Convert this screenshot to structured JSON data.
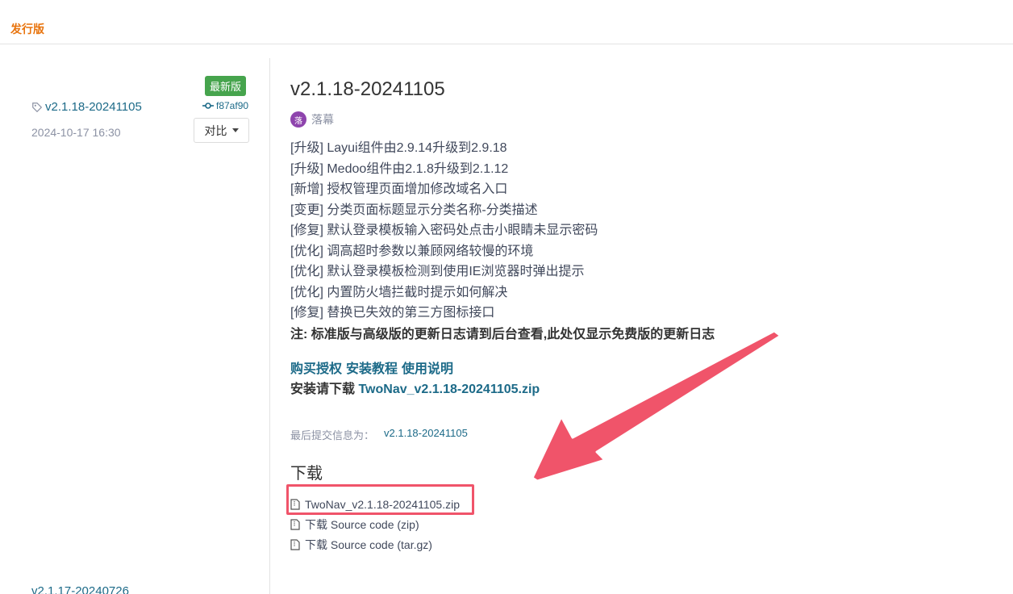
{
  "header": {
    "tab_label": "发行版"
  },
  "sidebar": {
    "release": {
      "tag": "v2.1.18-20241105",
      "date": "2024-10-17 16:30",
      "badge": "最新版",
      "commit": "f87af90",
      "compare_label": "对比"
    },
    "next_tag": "v2.1.17-20240726"
  },
  "release": {
    "title": "v2.1.18-20241105",
    "author_avatar_text": "落",
    "author": "落幕",
    "changelog": [
      "[升级] Layui组件由2.9.14升级到2.9.18",
      "[升级] Medoo组件由2.1.8升级到2.1.12",
      "[新增] 授权管理页面增加修改域名入口",
      "[变更] 分类页面标题显示分类名称-分类描述",
      "[修复] 默认登录模板输入密码处点击小眼睛未显示密码",
      "[优化] 调高超时参数以兼顾网络较慢的环境",
      "[优化] 默认登录模板检测到使用IE浏览器时弹出提示",
      "[优化] 内置防火墙拦截时提示如何解决",
      "[修复] 替换已失效的第三方图标接口"
    ],
    "note": "注: 标准版与高级版的更新日志请到后台查看,此处仅显示免费版的更新日志",
    "links": [
      "购买授权",
      "安装教程",
      "使用说明"
    ],
    "install_prefix": "安装请下载",
    "install_file": "TwoNav_v2.1.18-20241105.zip",
    "commit_info_label": "最后提交信息为：",
    "commit_info_value": "v2.1.18-20241105"
  },
  "downloads": {
    "title": "下载",
    "items": [
      "TwoNav_v2.1.18-20241105.zip",
      "下载 Source code (zip)",
      "下载 Source code (tar.gz)"
    ]
  },
  "colors": {
    "accent": "#e8730c",
    "link": "#1c6a88",
    "badge": "#46a44d",
    "highlight": "#f0546a"
  }
}
